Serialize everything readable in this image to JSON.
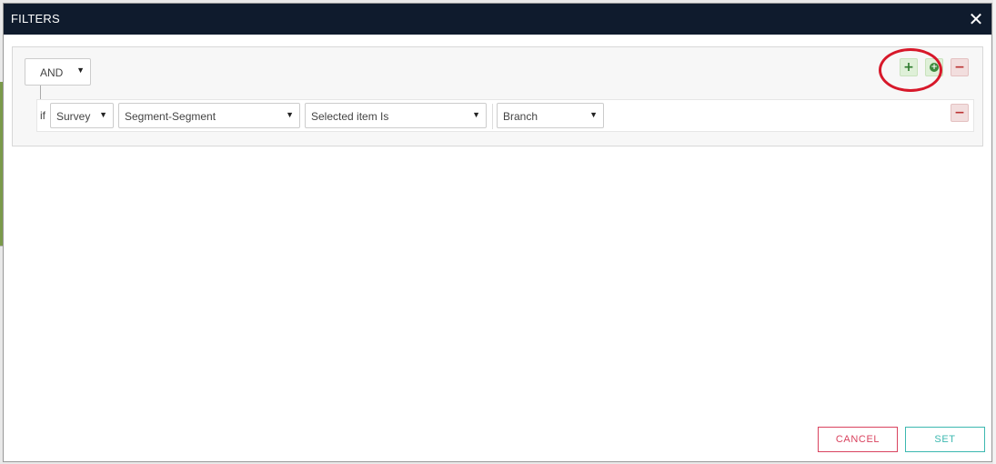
{
  "modal": {
    "title": "FILTERS",
    "close_icon": "close-icon",
    "close_glyph": "✕"
  },
  "group": {
    "operator": "AND",
    "add_rule_glyph": "+",
    "add_group_glyph": "+",
    "delete_group_glyph": "−"
  },
  "rule": {
    "if_label": "if",
    "source": "Survey",
    "field": "Segment-Segment",
    "operator": "Selected item Is",
    "value": "Branch",
    "delete_rule_glyph": "−"
  },
  "footer": {
    "cancel_label": "CANCEL",
    "set_label": "SET"
  },
  "colors": {
    "header_bg": "#0f1b2d",
    "cancel": "#d9435f",
    "set": "#3cb8b0",
    "annotation": "#d7182a"
  }
}
